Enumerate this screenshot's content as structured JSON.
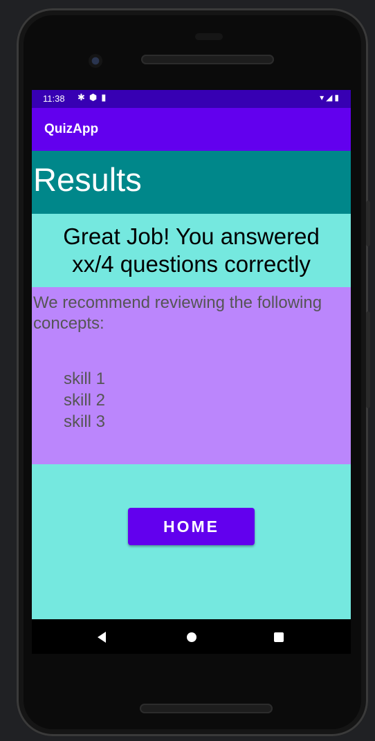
{
  "status_bar": {
    "time": "11:38",
    "left_icons": [
      "settings-icon",
      "shield-icon",
      "sd-card-icon"
    ],
    "right_icons": [
      "wifi-icon",
      "signal-icon",
      "battery-icon"
    ]
  },
  "app_bar": {
    "title": "QuizApp"
  },
  "results": {
    "title": "Results",
    "score_message": "Great Job! You answered xx/4 questions correctly",
    "recommend_text": "We recommend reviewing the following concepts:",
    "skills": [
      "skill 1",
      "skill 2",
      "skill 3"
    ]
  },
  "home_button": {
    "label": "HOME"
  },
  "nav_bar": {
    "icons": [
      "back-icon",
      "home-icon",
      "recents-icon"
    ]
  },
  "colors": {
    "status_bar": "#3700b3",
    "app_bar": "#6200ee",
    "results_header": "#00878a",
    "score_background": "#75e8df",
    "recommend_background": "#bb86fc",
    "button": "#6200ee"
  }
}
